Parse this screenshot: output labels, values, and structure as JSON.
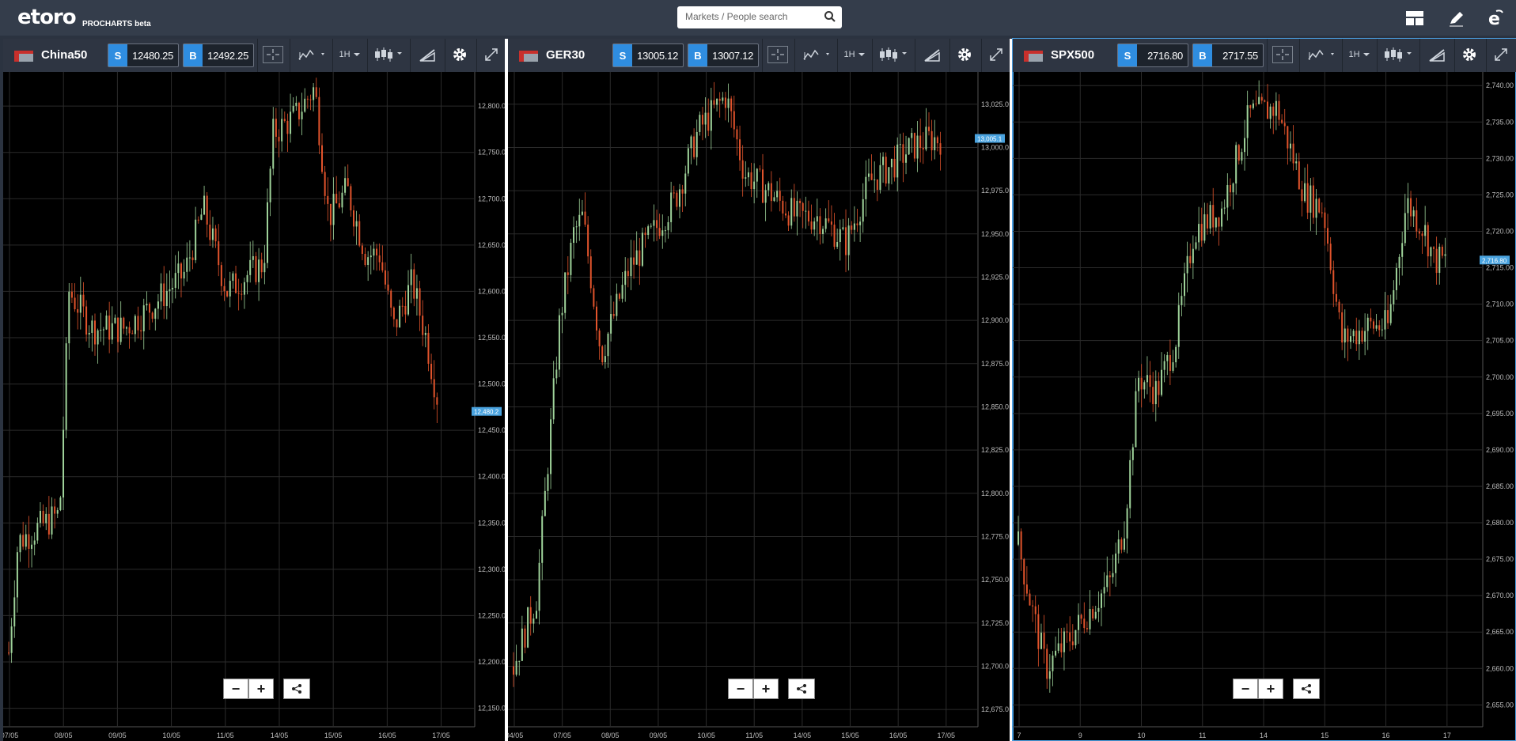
{
  "app": {
    "logo": "etoro",
    "sub": "PROCHARTS beta"
  },
  "search": {
    "placeholder": "Markets / People search"
  },
  "icons": {
    "search": "search-icon",
    "layout": "layout-icon",
    "pencil": "pencil-icon",
    "etoro": "etoro-e-icon"
  },
  "colors": {
    "sell_accent": "#2f8de0",
    "up_candle": "#9fd39a",
    "down_candle": "#e2542c",
    "active_border": "#4a9ee0"
  },
  "panels": [
    {
      "symbol": "China50",
      "sell": "12480.25",
      "buy": "12492.25",
      "sell_label": "S",
      "buy_label": "B",
      "timeframe": "1H",
      "price_tag": "12,480.2",
      "y_ticks": [
        "12,800.0",
        "12,750.0",
        "12,700.0",
        "12,650.0",
        "12,600.0",
        "12,550.0",
        "12,500.0",
        "12,450.0",
        "12,400.0",
        "12,350.0",
        "12,300.0",
        "12,250.0",
        "12,200.0",
        "12,150.0"
      ],
      "x_ticks": [
        "07/05",
        "08/05",
        "09/05",
        "10/05",
        "11/05",
        "14/05",
        "15/05",
        "16/05",
        "17/05"
      ]
    },
    {
      "symbol": "GER30",
      "sell": "13005.12",
      "buy": "13007.12",
      "sell_label": "S",
      "buy_label": "B",
      "timeframe": "1H",
      "price_tag": "13,005.1",
      "y_ticks": [
        "13,025.0",
        "13,000.0",
        "12,975.0",
        "12,950.0",
        "12,925.0",
        "12,900.0",
        "12,875.0",
        "12,850.0",
        "12,825.0",
        "12,800.0",
        "12,775.0",
        "12,750.0",
        "12,725.0",
        "12,700.0",
        "12,675.0"
      ],
      "x_ticks": [
        "04/05",
        "07/05",
        "08/05",
        "09/05",
        "10/05",
        "11/05",
        "14/05",
        "15/05",
        "16/05",
        "17/05"
      ]
    },
    {
      "symbol": "SPX500",
      "sell": "2716.80",
      "buy": "2717.55",
      "sell_label": "S",
      "buy_label": "B",
      "timeframe": "1H",
      "price_tag": "2,716.80",
      "y_ticks": [
        "2,740.00",
        "2,735.00",
        "2,730.00",
        "2,725.00",
        "2,720.00",
        "2,715.00",
        "2,710.00",
        "2,705.00",
        "2,700.00",
        "2,695.00",
        "2,690.00",
        "2,685.00",
        "2,680.00",
        "2,675.00",
        "2,670.00",
        "2,665.00",
        "2,660.00",
        "2,655.00"
      ],
      "x_ticks": [
        "7",
        "9",
        "10",
        "11",
        "14",
        "15",
        "16",
        "17"
      ]
    }
  ],
  "controls": {
    "zoom_out": "−",
    "zoom_in": "+"
  }
}
